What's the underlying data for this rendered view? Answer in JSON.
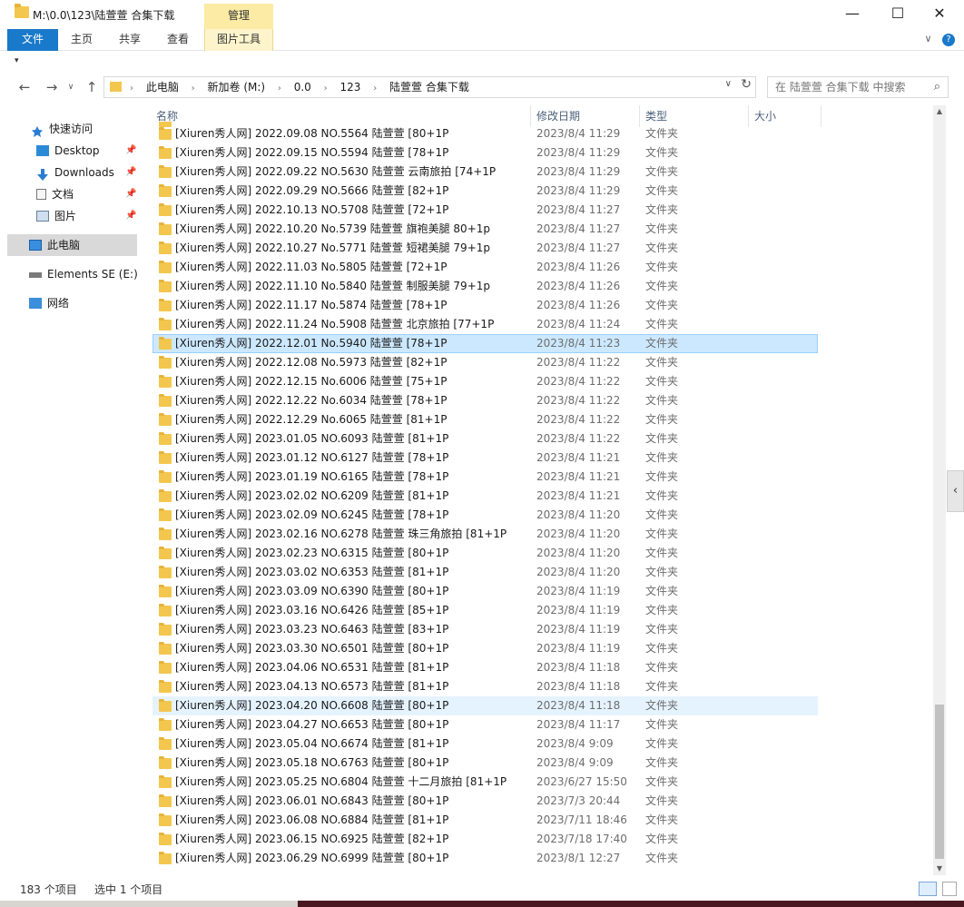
{
  "window": {
    "title": "M:\\0.0\\123\\陆萱萱 合集下载",
    "manage_tab": "管理",
    "minimize": "—",
    "maximize": "☐",
    "close": "✕"
  },
  "ribbon": {
    "tabs": [
      "文件",
      "主页",
      "共享",
      "查看",
      "图片工具"
    ],
    "expand": "∨",
    "help": "?"
  },
  "quick_access_toolbar": "▾",
  "address": {
    "back": "←",
    "forward": "→",
    "recent": "∨",
    "up": "↑",
    "crumbs": [
      "此电脑",
      "新加卷 (M:)",
      "0.0",
      "123",
      "陆萱萱 合集下载"
    ],
    "separator": "›",
    "dropdown": "∨",
    "refresh": "↻",
    "search_placeholder": "在 陆萱萱 合集下载 中搜索",
    "search_icon": "⌕"
  },
  "nav": {
    "items": [
      {
        "label": "快速访问",
        "icon": "star-icon",
        "pinned": false
      },
      {
        "label": "Desktop",
        "icon": "desktop-icon",
        "pinned": true
      },
      {
        "label": "Downloads",
        "icon": "download-icon",
        "pinned": true
      },
      {
        "label": "文档",
        "icon": "document-icon",
        "pinned": true
      },
      {
        "label": "图片",
        "icon": "picture-icon",
        "pinned": true
      },
      {
        "label": "此电脑",
        "icon": "computer-icon",
        "pinned": false
      },
      {
        "label": "Elements SE (E:)",
        "icon": "drive-icon",
        "pinned": false
      },
      {
        "label": "网络",
        "icon": "network-icon",
        "pinned": false
      }
    ],
    "pin_glyph": "📌"
  },
  "columns": [
    "名称",
    "修改日期",
    "类型",
    "大小"
  ],
  "sort_glyph": "^",
  "rows": [
    {
      "name": "[Xiuren秀人网] 2022.09.08 NO.5564 陆萱萱 [80+1P",
      "date": "2023/8/4 11:29",
      "type": "文件夹"
    },
    {
      "name": "[Xiuren秀人网] 2022.09.15 NO.5594 陆萱萱 [78+1P",
      "date": "2023/8/4 11:29",
      "type": "文件夹"
    },
    {
      "name": "[Xiuren秀人网] 2022.09.22 NO.5630 陆萱萱 云南旅拍 [74+1P",
      "date": "2023/8/4 11:29",
      "type": "文件夹"
    },
    {
      "name": "[Xiuren秀人网] 2022.09.29 NO.5666 陆萱萱 [82+1P",
      "date": "2023/8/4 11:29",
      "type": "文件夹"
    },
    {
      "name": "[Xiuren秀人网] 2022.10.13 NO.5708 陆萱萱 [72+1P",
      "date": "2023/8/4 11:27",
      "type": "文件夹"
    },
    {
      "name": "[Xiuren秀人网] 2022.10.20 No.5739 陆萱萱 旗袍美腿 80+1p",
      "date": "2023/8/4 11:27",
      "type": "文件夹"
    },
    {
      "name": "[Xiuren秀人网] 2022.10.27 No.5771 陆萱萱 短裙美腿 79+1p",
      "date": "2023/8/4 11:27",
      "type": "文件夹"
    },
    {
      "name": "[Xiuren秀人网] 2022.11.03 No.5805 陆萱萱 [72+1P",
      "date": "2023/8/4 11:26",
      "type": "文件夹"
    },
    {
      "name": "[Xiuren秀人网] 2022.11.10 No.5840 陆萱萱 制服美腿 79+1p",
      "date": "2023/8/4 11:26",
      "type": "文件夹"
    },
    {
      "name": "[Xiuren秀人网] 2022.11.17 No.5874 陆萱萱 [78+1P",
      "date": "2023/8/4 11:26",
      "type": "文件夹"
    },
    {
      "name": "[Xiuren秀人网] 2022.11.24 No.5908 陆萱萱 北京旅拍 [77+1P",
      "date": "2023/8/4 11:24",
      "type": "文件夹"
    },
    {
      "name": "[Xiuren秀人网] 2022.12.01 No.5940 陆萱萱 [78+1P",
      "date": "2023/8/4 11:23",
      "type": "文件夹",
      "state": "selected"
    },
    {
      "name": "[Xiuren秀人网] 2022.12.08 No.5973 陆萱萱 [82+1P",
      "date": "2023/8/4 11:22",
      "type": "文件夹"
    },
    {
      "name": "[Xiuren秀人网] 2022.12.15 No.6006 陆萱萱 [75+1P",
      "date": "2023/8/4 11:22",
      "type": "文件夹"
    },
    {
      "name": "[Xiuren秀人网] 2022.12.22 No.6034 陆萱萱 [78+1P",
      "date": "2023/8/4 11:22",
      "type": "文件夹"
    },
    {
      "name": "[Xiuren秀人网] 2022.12.29 No.6065 陆萱萱 [81+1P",
      "date": "2023/8/4 11:22",
      "type": "文件夹"
    },
    {
      "name": "[Xiuren秀人网] 2023.01.05 NO.6093 陆萱萱 [81+1P",
      "date": "2023/8/4 11:22",
      "type": "文件夹"
    },
    {
      "name": "[Xiuren秀人网] 2023.01.12 NO.6127 陆萱萱 [78+1P",
      "date": "2023/8/4 11:21",
      "type": "文件夹"
    },
    {
      "name": "[Xiuren秀人网] 2023.01.19 NO.6165 陆萱萱 [78+1P",
      "date": "2023/8/4 11:21",
      "type": "文件夹"
    },
    {
      "name": "[Xiuren秀人网] 2023.02.02 NO.6209 陆萱萱 [81+1P",
      "date": "2023/8/4 11:21",
      "type": "文件夹"
    },
    {
      "name": "[Xiuren秀人网] 2023.02.09 NO.6245 陆萱萱 [78+1P",
      "date": "2023/8/4 11:20",
      "type": "文件夹"
    },
    {
      "name": "[Xiuren秀人网] 2023.02.16 NO.6278 陆萱萱 珠三角旅拍 [81+1P",
      "date": "2023/8/4 11:20",
      "type": "文件夹"
    },
    {
      "name": "[Xiuren秀人网] 2023.02.23 NO.6315 陆萱萱 [80+1P",
      "date": "2023/8/4 11:20",
      "type": "文件夹"
    },
    {
      "name": "[Xiuren秀人网] 2023.03.02 NO.6353 陆萱萱 [81+1P",
      "date": "2023/8/4 11:20",
      "type": "文件夹"
    },
    {
      "name": "[Xiuren秀人网] 2023.03.09 NO.6390 陆萱萱 [80+1P",
      "date": "2023/8/4 11:19",
      "type": "文件夹"
    },
    {
      "name": "[Xiuren秀人网] 2023.03.16 NO.6426 陆萱萱 [85+1P",
      "date": "2023/8/4 11:19",
      "type": "文件夹"
    },
    {
      "name": "[Xiuren秀人网] 2023.03.23 NO.6463 陆萱萱 [83+1P",
      "date": "2023/8/4 11:19",
      "type": "文件夹"
    },
    {
      "name": "[Xiuren秀人网] 2023.03.30 NO.6501 陆萱萱 [80+1P",
      "date": "2023/8/4 11:19",
      "type": "文件夹"
    },
    {
      "name": "[Xiuren秀人网] 2023.04.06 NO.6531 陆萱萱 [81+1P",
      "date": "2023/8/4 11:18",
      "type": "文件夹"
    },
    {
      "name": "[Xiuren秀人网] 2023.04.13 NO.6573 陆萱萱 [81+1P",
      "date": "2023/8/4 11:18",
      "type": "文件夹"
    },
    {
      "name": "[Xiuren秀人网] 2023.04.20 NO.6608 陆萱萱 [80+1P",
      "date": "2023/8/4 11:18",
      "type": "文件夹",
      "state": "hover"
    },
    {
      "name": "[Xiuren秀人网] 2023.04.27 NO.6653 陆萱萱 [80+1P",
      "date": "2023/8/4 11:17",
      "type": "文件夹"
    },
    {
      "name": "[Xiuren秀人网] 2023.05.04 NO.6674 陆萱萱 [81+1P",
      "date": "2023/8/4 9:09",
      "type": "文件夹"
    },
    {
      "name": "[Xiuren秀人网] 2023.05.18 NO.6763 陆萱萱 [80+1P",
      "date": "2023/8/4 9:09",
      "type": "文件夹"
    },
    {
      "name": "[Xiuren秀人网] 2023.05.25 NO.6804 陆萱萱 十二月旅拍 [81+1P",
      "date": "2023/6/27 15:50",
      "type": "文件夹"
    },
    {
      "name": "[Xiuren秀人网] 2023.06.01 NO.6843 陆萱萱 [80+1P",
      "date": "2023/7/3 20:44",
      "type": "文件夹"
    },
    {
      "name": "[Xiuren秀人网] 2023.06.08 NO.6884 陆萱萱 [81+1P",
      "date": "2023/7/11 18:46",
      "type": "文件夹"
    },
    {
      "name": "[Xiuren秀人网] 2023.06.15 NO.6925 陆萱萱 [82+1P",
      "date": "2023/7/18 17:40",
      "type": "文件夹"
    },
    {
      "name": "[Xiuren秀人网] 2023.06.29 NO.6999 陆萱萱 [80+1P",
      "date": "2023/8/1 12:27",
      "type": "文件夹"
    }
  ],
  "scrollbar": {
    "up": "▲",
    "down": "▼"
  },
  "side_handle": "‹",
  "status": {
    "count": "183 个项目",
    "selected": "选中 1 个项目"
  },
  "colors": {
    "file_tab": "#1979ca",
    "manage_tab": "#fbeba4",
    "selection": "#cce8ff",
    "hover": "#e5f3ff",
    "folder": "#f3c74e"
  }
}
